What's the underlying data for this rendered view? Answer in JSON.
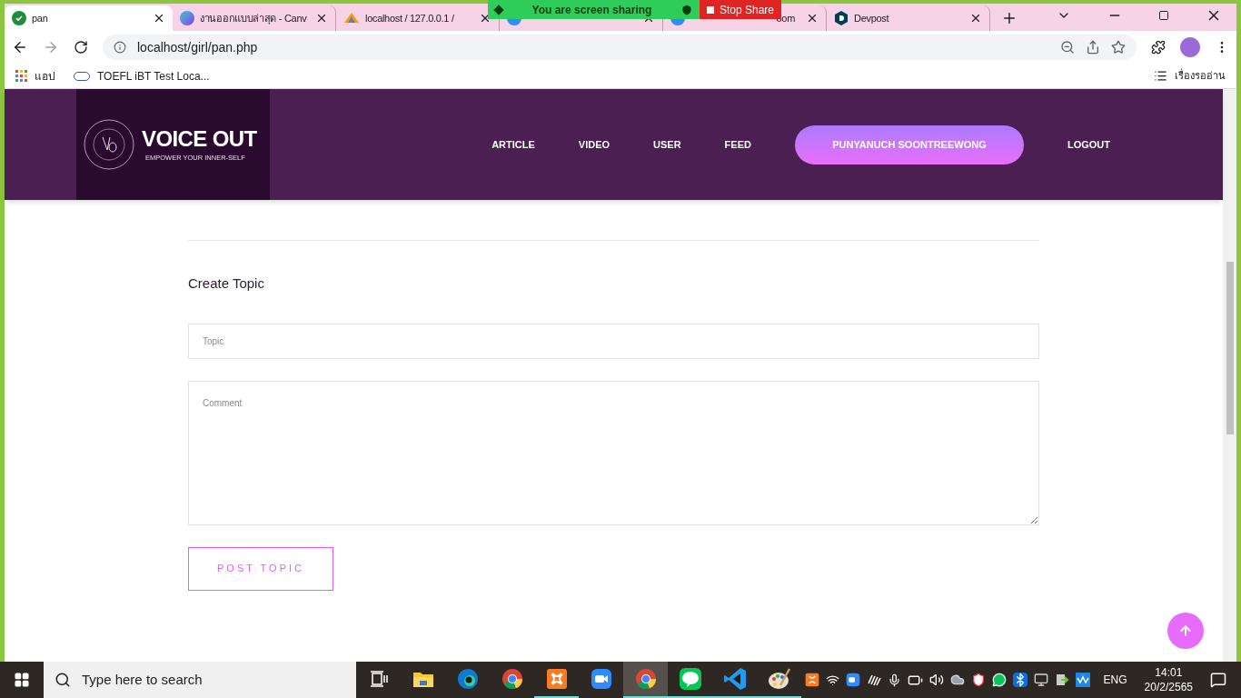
{
  "browser": {
    "tabs": [
      {
        "kind": "check",
        "label": "pan",
        "selected": true
      },
      {
        "kind": "canva",
        "label": "งานออกแบบล่าสุด - Canv",
        "selected": false
      },
      {
        "kind": "pma",
        "label": "localhost / 127.0.0.1 /",
        "selected": false
      },
      {
        "kind": "blue",
        "selected": false
      },
      {
        "kind": "blue",
        "label": "oom",
        "selected": false
      },
      {
        "kind": "devpost",
        "label": "Devpost",
        "selected": false
      }
    ],
    "url": "localhost/girl/pan.php",
    "bookmarks": [
      {
        "kind": "apps",
        "label": "แอป"
      },
      {
        "kind": "ets",
        "label": "TOEFL iBT Test Loca..."
      }
    ],
    "reading_list": "เรื่องรออ่าน"
  },
  "share_banner": {
    "status": "You are screen sharing",
    "stop": "Stop Share"
  },
  "site": {
    "logo": {
      "title": "VOICE OUT",
      "tagline": "EMPOWER YOUR INNER-SELF"
    },
    "nav": [
      {
        "kind": "link",
        "label": "ARTICLE"
      },
      {
        "kind": "link",
        "label": "VIDEO"
      },
      {
        "kind": "link",
        "label": "USER"
      },
      {
        "kind": "link",
        "label": "FEED"
      },
      {
        "kind": "pill",
        "label": "PUNYANUCH SOONTREEWONG"
      },
      {
        "kind": "link",
        "label": "LOGOUT"
      }
    ],
    "form": {
      "heading": "Create Topic",
      "topic": {
        "placeholder": "Topic"
      },
      "comment": {
        "placeholder": "Comment"
      },
      "submit": "POST TOPIC"
    }
  },
  "taskbar": {
    "search": {
      "placeholder": "Type here to search"
    },
    "apps": [
      {
        "kind": "taskview",
        "running": false,
        "selected": false
      },
      {
        "kind": "folder",
        "running": false,
        "selected": false
      },
      {
        "kind": "edge",
        "running": false,
        "selected": false
      },
      {
        "kind": "chrome",
        "running": false,
        "selected": false
      },
      {
        "kind": "xampp",
        "running": true,
        "selected": false
      },
      {
        "kind": "zoom",
        "running": false,
        "selected": false
      },
      {
        "kind": "chrome",
        "running": true,
        "selected": true
      },
      {
        "kind": "line",
        "running": true,
        "selected": false
      },
      {
        "kind": "vscode",
        "running": true,
        "selected": false
      },
      {
        "kind": "paint",
        "running": true,
        "selected": false
      }
    ],
    "language": "ENG",
    "time": "14:01",
    "date": "20/2/2565"
  }
}
